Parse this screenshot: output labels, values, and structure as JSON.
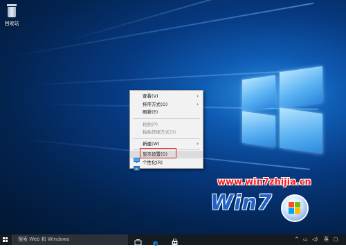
{
  "desktop": {
    "recycle_bin_label": "回收站"
  },
  "context_menu": {
    "items": [
      {
        "label": "查看(V)",
        "has_submenu": true,
        "disabled": false
      },
      {
        "label": "排序方式(O)",
        "has_submenu": true,
        "disabled": false
      },
      {
        "label": "刷新(E)",
        "has_submenu": false,
        "disabled": false
      },
      {
        "label": "粘贴(P)",
        "has_submenu": false,
        "disabled": true
      },
      {
        "label": "粘贴快捷方式(S)",
        "has_submenu": false,
        "disabled": true
      },
      {
        "label": "新建(W)",
        "has_submenu": true,
        "disabled": false
      },
      {
        "label": "显示设置(D)",
        "has_submenu": false,
        "disabled": false,
        "icon": "display-icon",
        "highlighted": true
      },
      {
        "label": "个性化(R)",
        "has_submenu": false,
        "disabled": false,
        "icon": "personalize-icon"
      }
    ],
    "submenu_arrow": "›"
  },
  "watermark": {
    "url": "www.win7zhijia.cn",
    "brand": "Win7"
  },
  "taskbar": {
    "search_placeholder": "搜索 Web 和 Windows",
    "ime_label": "英",
    "accent_color": "#0078d7"
  },
  "colors": {
    "highlight_border": "#e02020",
    "menu_background": "#f2f2f2"
  }
}
